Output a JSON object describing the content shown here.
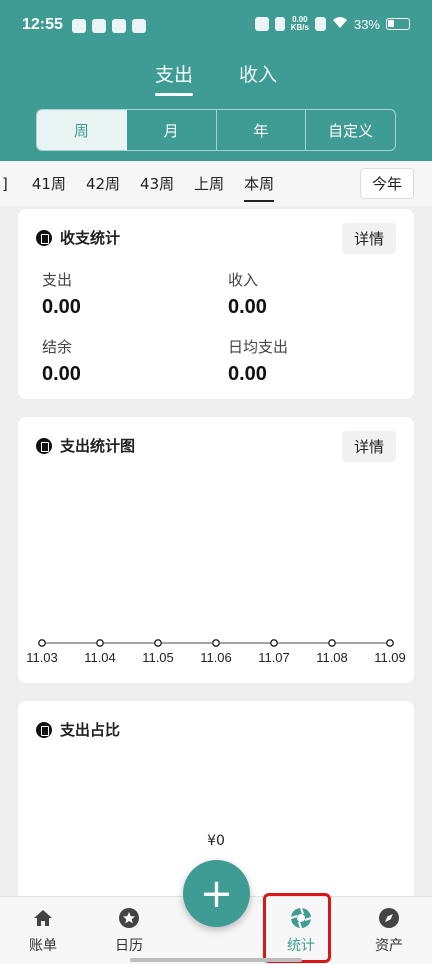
{
  "status_bar": {
    "time": "12:55",
    "net_speed_value": "0.00",
    "net_speed_unit": "KB/s",
    "battery": "33%"
  },
  "mode_tabs": [
    {
      "label": "支出",
      "active": true
    },
    {
      "label": "收入",
      "active": false
    }
  ],
  "period_tabs": [
    {
      "label": "周",
      "active": true
    },
    {
      "label": "月",
      "active": false
    },
    {
      "label": "年",
      "active": false
    },
    {
      "label": "自定义",
      "active": false
    }
  ],
  "week_strip": {
    "items": [
      "]",
      "41周",
      "42周",
      "43周",
      "上周",
      "本周"
    ],
    "active": "本周",
    "year_button": "今年"
  },
  "summary_card": {
    "title": "收支统计",
    "detail_label": "详情",
    "icon": "ledger-icon",
    "expense_label": "支出",
    "expense_value": "0.00",
    "income_label": "收入",
    "income_value": "0.00",
    "balance_label": "结余",
    "balance_value": "0.00",
    "daily_label": "日均支出",
    "daily_value": "0.00"
  },
  "chart_card": {
    "title": "支出统计图",
    "detail_label": "详情",
    "icon": "chart-icon"
  },
  "chart_data": {
    "type": "line",
    "categories": [
      "11.03",
      "11.04",
      "11.05",
      "11.06",
      "11.07",
      "11.08",
      "11.09"
    ],
    "values": [
      0,
      0,
      0,
      0,
      0,
      0,
      0
    ],
    "title": "",
    "xlabel": "",
    "ylabel": "",
    "grid": false
  },
  "share_card": {
    "title": "支出占比",
    "icon": "medal-icon",
    "total": "¥0"
  },
  "bottom_nav": [
    {
      "label": "账单",
      "icon": "home-icon",
      "active": false
    },
    {
      "label": "日历",
      "icon": "star-icon",
      "active": false
    },
    {
      "label": "统计",
      "icon": "aperture-icon",
      "active": true
    },
    {
      "label": "资产",
      "icon": "compass-icon",
      "active": false
    }
  ],
  "fab_symbol": "+",
  "colors": {
    "primary": "#3f9c94",
    "highlight": "#d81818"
  }
}
